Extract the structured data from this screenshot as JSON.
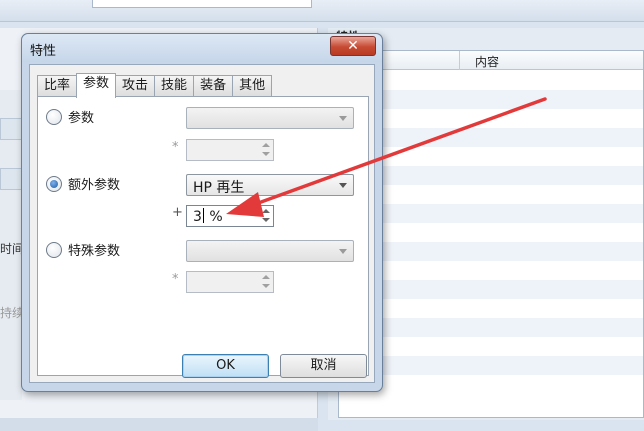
{
  "background": {
    "left_labels": [
      "时间",
      "持续"
    ],
    "right_panel_title": "特性",
    "table_header": {
      "col2": "内容"
    }
  },
  "dialog": {
    "title": "特性",
    "close_glyph": "✕",
    "tabs": [
      {
        "label": "比率",
        "active": false
      },
      {
        "label": "参数",
        "active": true
      },
      {
        "label": "攻击",
        "active": false
      },
      {
        "label": "技能",
        "active": false
      },
      {
        "label": "装备",
        "active": false
      },
      {
        "label": "其他",
        "active": false
      }
    ],
    "options": [
      {
        "label": "参数",
        "checked": false,
        "combo_value": "",
        "operator": "*",
        "spin_value": ""
      },
      {
        "label": "额外参数",
        "checked": true,
        "combo_value": "HP 再生",
        "operator": "+",
        "spin_value_before_caret": "3",
        "spin_value_after_caret": " %"
      },
      {
        "label": "特殊参数",
        "checked": false,
        "combo_value": "",
        "operator": "*",
        "spin_value": ""
      }
    ],
    "ok_label": "OK",
    "cancel_label": "取消"
  },
  "annotation": {
    "arrow_color": "#e23a3a"
  }
}
